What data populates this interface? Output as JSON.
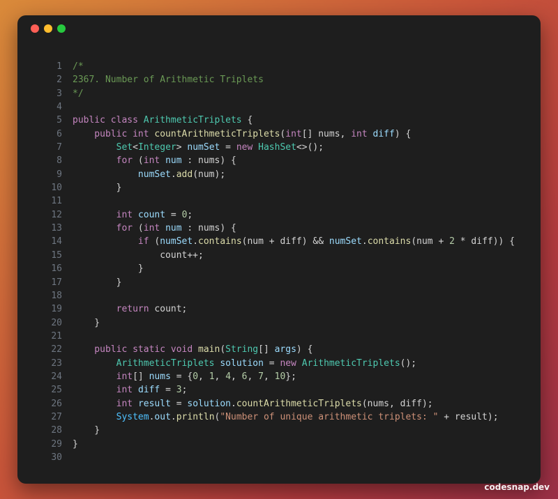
{
  "window": {
    "controls": [
      "close",
      "minimize",
      "maximize"
    ]
  },
  "editor": {
    "lines": [
      {
        "n": "1",
        "tokens": [
          {
            "t": "/*",
            "c": "c"
          }
        ]
      },
      {
        "n": "2",
        "tokens": [
          {
            "t": "2367. Number of Arithmetic Triplets",
            "c": "c"
          }
        ]
      },
      {
        "n": "3",
        "tokens": [
          {
            "t": "*/",
            "c": "c"
          }
        ]
      },
      {
        "n": "4",
        "tokens": []
      },
      {
        "n": "5",
        "tokens": [
          {
            "t": "public class ",
            "c": "k"
          },
          {
            "t": "ArithmeticTriplets",
            "c": "ty"
          },
          {
            "t": " {",
            "c": "p"
          }
        ]
      },
      {
        "n": "6",
        "tokens": [
          {
            "t": "    public ",
            "c": "k"
          },
          {
            "t": "int ",
            "c": "k"
          },
          {
            "t": "countArithmeticTriplets",
            "c": "f"
          },
          {
            "t": "(",
            "c": "p"
          },
          {
            "t": "int",
            "c": "k"
          },
          {
            "t": "[] nums, ",
            "c": "p"
          },
          {
            "t": "int ",
            "c": "k"
          },
          {
            "t": "diff",
            "c": "v"
          },
          {
            "t": ") {",
            "c": "p"
          }
        ]
      },
      {
        "n": "7",
        "tokens": [
          {
            "t": "        ",
            "c": "p"
          },
          {
            "t": "Set",
            "c": "ty"
          },
          {
            "t": "<",
            "c": "p"
          },
          {
            "t": "Integer",
            "c": "ty"
          },
          {
            "t": "> ",
            "c": "p"
          },
          {
            "t": "numSet",
            "c": "v"
          },
          {
            "t": " = ",
            "c": "p"
          },
          {
            "t": "new ",
            "c": "k"
          },
          {
            "t": "HashSet",
            "c": "ty"
          },
          {
            "t": "<>();",
            "c": "p"
          }
        ]
      },
      {
        "n": "8",
        "tokens": [
          {
            "t": "        ",
            "c": "p"
          },
          {
            "t": "for",
            "c": "k"
          },
          {
            "t": " (",
            "c": "p"
          },
          {
            "t": "int ",
            "c": "k"
          },
          {
            "t": "num",
            "c": "v"
          },
          {
            "t": " : nums) {",
            "c": "p"
          }
        ]
      },
      {
        "n": "9",
        "tokens": [
          {
            "t": "            ",
            "c": "p"
          },
          {
            "t": "numSet",
            "c": "v"
          },
          {
            "t": ".",
            "c": "p"
          },
          {
            "t": "add",
            "c": "f"
          },
          {
            "t": "(num);",
            "c": "p"
          }
        ]
      },
      {
        "n": "10",
        "tokens": [
          {
            "t": "        }",
            "c": "p"
          }
        ]
      },
      {
        "n": "11",
        "tokens": []
      },
      {
        "n": "12",
        "tokens": [
          {
            "t": "        ",
            "c": "p"
          },
          {
            "t": "int ",
            "c": "k"
          },
          {
            "t": "count",
            "c": "v"
          },
          {
            "t": " = ",
            "c": "p"
          },
          {
            "t": "0",
            "c": "n"
          },
          {
            "t": ";",
            "c": "p"
          }
        ]
      },
      {
        "n": "13",
        "tokens": [
          {
            "t": "        ",
            "c": "p"
          },
          {
            "t": "for",
            "c": "k"
          },
          {
            "t": " (",
            "c": "p"
          },
          {
            "t": "int ",
            "c": "k"
          },
          {
            "t": "num",
            "c": "v"
          },
          {
            "t": " : nums) {",
            "c": "p"
          }
        ]
      },
      {
        "n": "14",
        "tokens": [
          {
            "t": "            ",
            "c": "p"
          },
          {
            "t": "if",
            "c": "k"
          },
          {
            "t": " (",
            "c": "p"
          },
          {
            "t": "numSet",
            "c": "v"
          },
          {
            "t": ".",
            "c": "p"
          },
          {
            "t": "contains",
            "c": "f"
          },
          {
            "t": "(num + diff) && ",
            "c": "p"
          },
          {
            "t": "numSet",
            "c": "v"
          },
          {
            "t": ".",
            "c": "p"
          },
          {
            "t": "contains",
            "c": "f"
          },
          {
            "t": "(num + ",
            "c": "p"
          },
          {
            "t": "2",
            "c": "n"
          },
          {
            "t": " * diff)) {",
            "c": "p"
          }
        ]
      },
      {
        "n": "15",
        "tokens": [
          {
            "t": "                count++;",
            "c": "p"
          }
        ]
      },
      {
        "n": "16",
        "tokens": [
          {
            "t": "            }",
            "c": "p"
          }
        ]
      },
      {
        "n": "17",
        "tokens": [
          {
            "t": "        }",
            "c": "p"
          }
        ]
      },
      {
        "n": "18",
        "tokens": []
      },
      {
        "n": "19",
        "tokens": [
          {
            "t": "        ",
            "c": "p"
          },
          {
            "t": "return",
            "c": "k"
          },
          {
            "t": " count;",
            "c": "p"
          }
        ]
      },
      {
        "n": "20",
        "tokens": [
          {
            "t": "    }",
            "c": "p"
          }
        ]
      },
      {
        "n": "21",
        "tokens": []
      },
      {
        "n": "22",
        "tokens": [
          {
            "t": "    public static void ",
            "c": "k"
          },
          {
            "t": "main",
            "c": "f"
          },
          {
            "t": "(",
            "c": "p"
          },
          {
            "t": "String",
            "c": "ty"
          },
          {
            "t": "[] ",
            "c": "p"
          },
          {
            "t": "args",
            "c": "v"
          },
          {
            "t": ") {",
            "c": "p"
          }
        ]
      },
      {
        "n": "23",
        "tokens": [
          {
            "t": "        ",
            "c": "p"
          },
          {
            "t": "ArithmeticTriplets",
            "c": "ty"
          },
          {
            "t": " ",
            "c": "p"
          },
          {
            "t": "solution",
            "c": "v"
          },
          {
            "t": " = ",
            "c": "p"
          },
          {
            "t": "new ",
            "c": "k"
          },
          {
            "t": "ArithmeticTriplets",
            "c": "ty"
          },
          {
            "t": "();",
            "c": "p"
          }
        ]
      },
      {
        "n": "24",
        "tokens": [
          {
            "t": "        ",
            "c": "p"
          },
          {
            "t": "int",
            "c": "k"
          },
          {
            "t": "[] ",
            "c": "p"
          },
          {
            "t": "nums",
            "c": "v"
          },
          {
            "t": " = {",
            "c": "p"
          },
          {
            "t": "0",
            "c": "n"
          },
          {
            "t": ", ",
            "c": "p"
          },
          {
            "t": "1",
            "c": "n"
          },
          {
            "t": ", ",
            "c": "p"
          },
          {
            "t": "4",
            "c": "n"
          },
          {
            "t": ", ",
            "c": "p"
          },
          {
            "t": "6",
            "c": "n"
          },
          {
            "t": ", ",
            "c": "p"
          },
          {
            "t": "7",
            "c": "n"
          },
          {
            "t": ", ",
            "c": "p"
          },
          {
            "t": "10",
            "c": "n"
          },
          {
            "t": "};",
            "c": "p"
          }
        ]
      },
      {
        "n": "25",
        "tokens": [
          {
            "t": "        ",
            "c": "p"
          },
          {
            "t": "int ",
            "c": "k"
          },
          {
            "t": "diff",
            "c": "v"
          },
          {
            "t": " = ",
            "c": "p"
          },
          {
            "t": "3",
            "c": "n"
          },
          {
            "t": ";",
            "c": "p"
          }
        ]
      },
      {
        "n": "26",
        "tokens": [
          {
            "t": "        ",
            "c": "p"
          },
          {
            "t": "int ",
            "c": "k"
          },
          {
            "t": "result",
            "c": "v"
          },
          {
            "t": " = ",
            "c": "p"
          },
          {
            "t": "solution",
            "c": "v"
          },
          {
            "t": ".",
            "c": "p"
          },
          {
            "t": "countArithmeticTriplets",
            "c": "f"
          },
          {
            "t": "(nums, diff);",
            "c": "p"
          }
        ]
      },
      {
        "n": "27",
        "tokens": [
          {
            "t": "        ",
            "c": "p"
          },
          {
            "t": "System",
            "c": "cls"
          },
          {
            "t": ".",
            "c": "p"
          },
          {
            "t": "out",
            "c": "v"
          },
          {
            "t": ".",
            "c": "p"
          },
          {
            "t": "println",
            "c": "f"
          },
          {
            "t": "(",
            "c": "p"
          },
          {
            "t": "\"Number of unique arithmetic triplets: \"",
            "c": "s"
          },
          {
            "t": " + result);",
            "c": "p"
          }
        ]
      },
      {
        "n": "28",
        "tokens": [
          {
            "t": "    }",
            "c": "p"
          }
        ]
      },
      {
        "n": "29",
        "tokens": [
          {
            "t": "}",
            "c": "p"
          }
        ]
      },
      {
        "n": "30",
        "tokens": []
      }
    ]
  },
  "watermark": "codesnap.dev"
}
